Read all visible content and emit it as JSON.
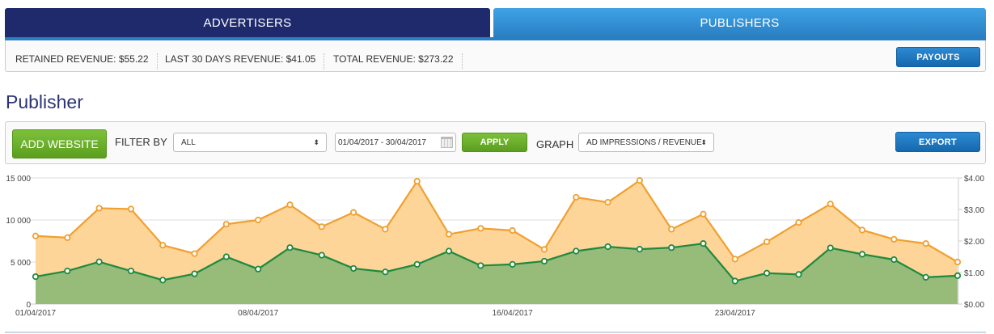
{
  "tabs": {
    "advertisers": "ADVERTISERS",
    "publishers": "PUBLISHERS"
  },
  "revenue": {
    "retained_label": "RETAINED REVENUE:",
    "retained_value": "$55.22",
    "last30_label": "LAST 30 DAYS REVENUE:",
    "last30_value": "$41.05",
    "total_label": "TOTAL REVENUE:",
    "total_value": "$273.22",
    "payouts_label": "PAYOUTS"
  },
  "page_title": "Publisher",
  "toolbar": {
    "add_website_label": "ADD WEBSITE",
    "filter_by_label": "FILTER BY",
    "filter_value": "ALL",
    "date_range": "01/04/2017 - 30/04/2017",
    "apply_label": "APPLY",
    "graph_label": "GRAPH",
    "graph_value": "AD IMPRESSIONS / REVENUE",
    "export_label": "EXPORT"
  },
  "chart_data": {
    "type": "area",
    "x": [
      "01/04/2017",
      "02/04/2017",
      "03/04/2017",
      "04/04/2017",
      "05/04/2017",
      "06/04/2017",
      "07/04/2017",
      "08/04/2017",
      "09/04/2017",
      "10/04/2017",
      "11/04/2017",
      "12/04/2017",
      "13/04/2017",
      "14/04/2017",
      "15/04/2017",
      "16/04/2017",
      "17/04/2017",
      "18/04/2017",
      "19/04/2017",
      "20/04/2017",
      "21/04/2017",
      "22/04/2017",
      "23/04/2017",
      "24/04/2017",
      "25/04/2017",
      "26/04/2017",
      "27/04/2017",
      "28/04/2017",
      "29/04/2017",
      "30/04/2017"
    ],
    "x_tick_labels": [
      "01/04/2017",
      "08/04/2017",
      "16/04/2017",
      "23/04/2017"
    ],
    "x_tick_indices": [
      0,
      7,
      15,
      22
    ],
    "left_axis": {
      "ylim": [
        0,
        15000
      ],
      "ticks": [
        "0",
        "5 000",
        "10 000",
        "15 000"
      ],
      "tick_values": [
        0,
        5000,
        10000,
        15000
      ]
    },
    "right_axis": {
      "ylim": [
        0,
        4
      ],
      "ticks": [
        "$0.00",
        "$1.00",
        "$2.00",
        "$3.00",
        "$4.00"
      ],
      "tick_values": [
        0,
        1,
        2,
        3,
        4
      ]
    },
    "grid": true,
    "series": [
      {
        "axis": "left",
        "color": "#f0a030",
        "fill": "#fdd599",
        "values": [
          8100,
          7900,
          11400,
          11300,
          7000,
          6000,
          9500,
          10000,
          11800,
          9200,
          10900,
          8900,
          14600,
          8300,
          9000,
          8750,
          6500,
          12700,
          12100,
          14700,
          8900,
          10700,
          5350,
          7400,
          9700,
          11900,
          8800,
          7700,
          7200,
          5000
        ]
      },
      {
        "axis": "right",
        "color": "#1e8a3e",
        "fill": "#97bb78",
        "values": [
          0.87,
          1.05,
          1.34,
          1.05,
          0.76,
          0.96,
          1.5,
          1.11,
          1.79,
          1.55,
          1.13,
          1.02,
          1.26,
          1.68,
          1.22,
          1.26,
          1.36,
          1.68,
          1.82,
          1.74,
          1.79,
          1.92,
          0.73,
          0.98,
          0.94,
          1.78,
          1.58,
          1.41,
          0.85,
          0.9
        ]
      }
    ]
  }
}
